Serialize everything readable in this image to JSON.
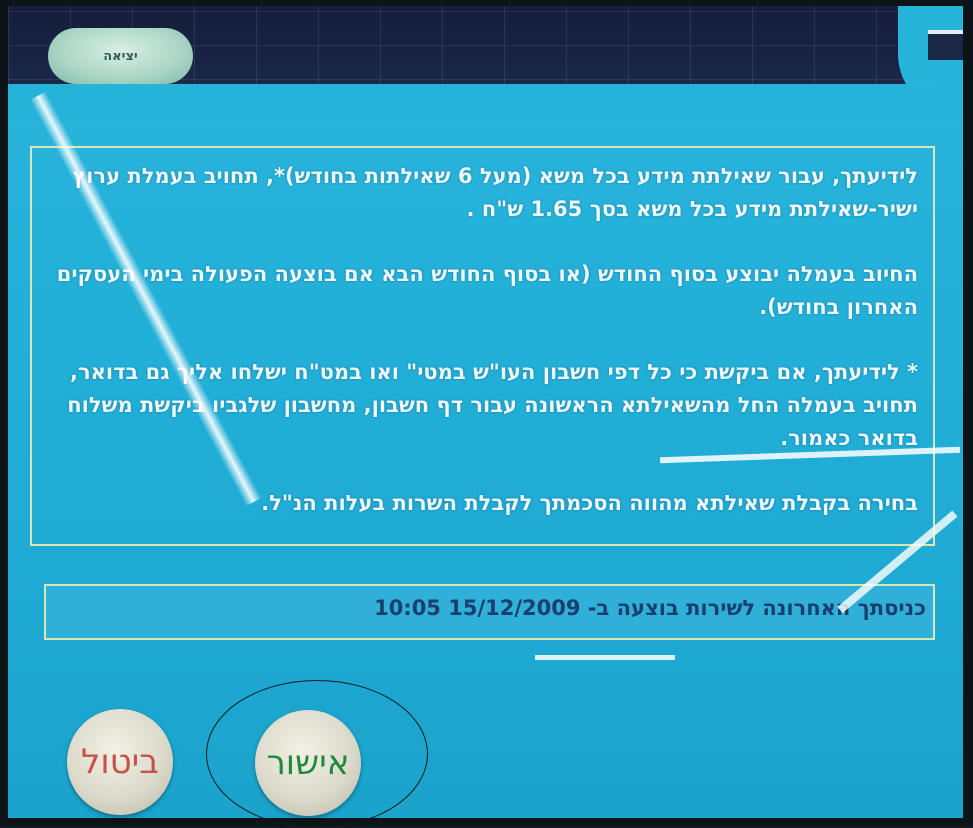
{
  "header": {
    "identify_button_label": "יציאה"
  },
  "info": {
    "paragraphs": [
      "לידיעתך, עבור שאילתת מידע בכל משא (מעל 6 שאילתות בחודש)*, תחויב בעמלת ערוץ ישיר-שאילתת מידע בכל משא בסך 1.65 ש\"ח .",
      "החיוב בעמלה יבוצע בסוף החודש (או בסוף החודש הבא אם בוצעה הפעולה בימי העסקים האחרון בחודש).",
      "* לידיעתך, אם ביקשת כי כל דפי חשבון העו\"ש במטי\" ואו במט\"ח ישלחו אליך גם בדואר, תחויב בעמלה החל מהשאילתא הראשונה עבור דף חשבון, מחשבון שלגביו ביקשת משלוח בדואר כאמור.",
      "בחירה בקבלת שאילתא מהווה הסכמתך לקבלת השרות בעלות הנ\"ל."
    ]
  },
  "last_service": {
    "text": "כניסתך האחרונה לשירות בוצעה ב- 15/12/2009 10:05"
  },
  "actions": {
    "cancel_label": "ביטול",
    "confirm_label": "אישור"
  },
  "colors": {
    "screen": "#22b0d8",
    "confirm_text": "#1e8a3a",
    "cancel_text": "#c6534a",
    "box_border": "#d8e7b8"
  }
}
